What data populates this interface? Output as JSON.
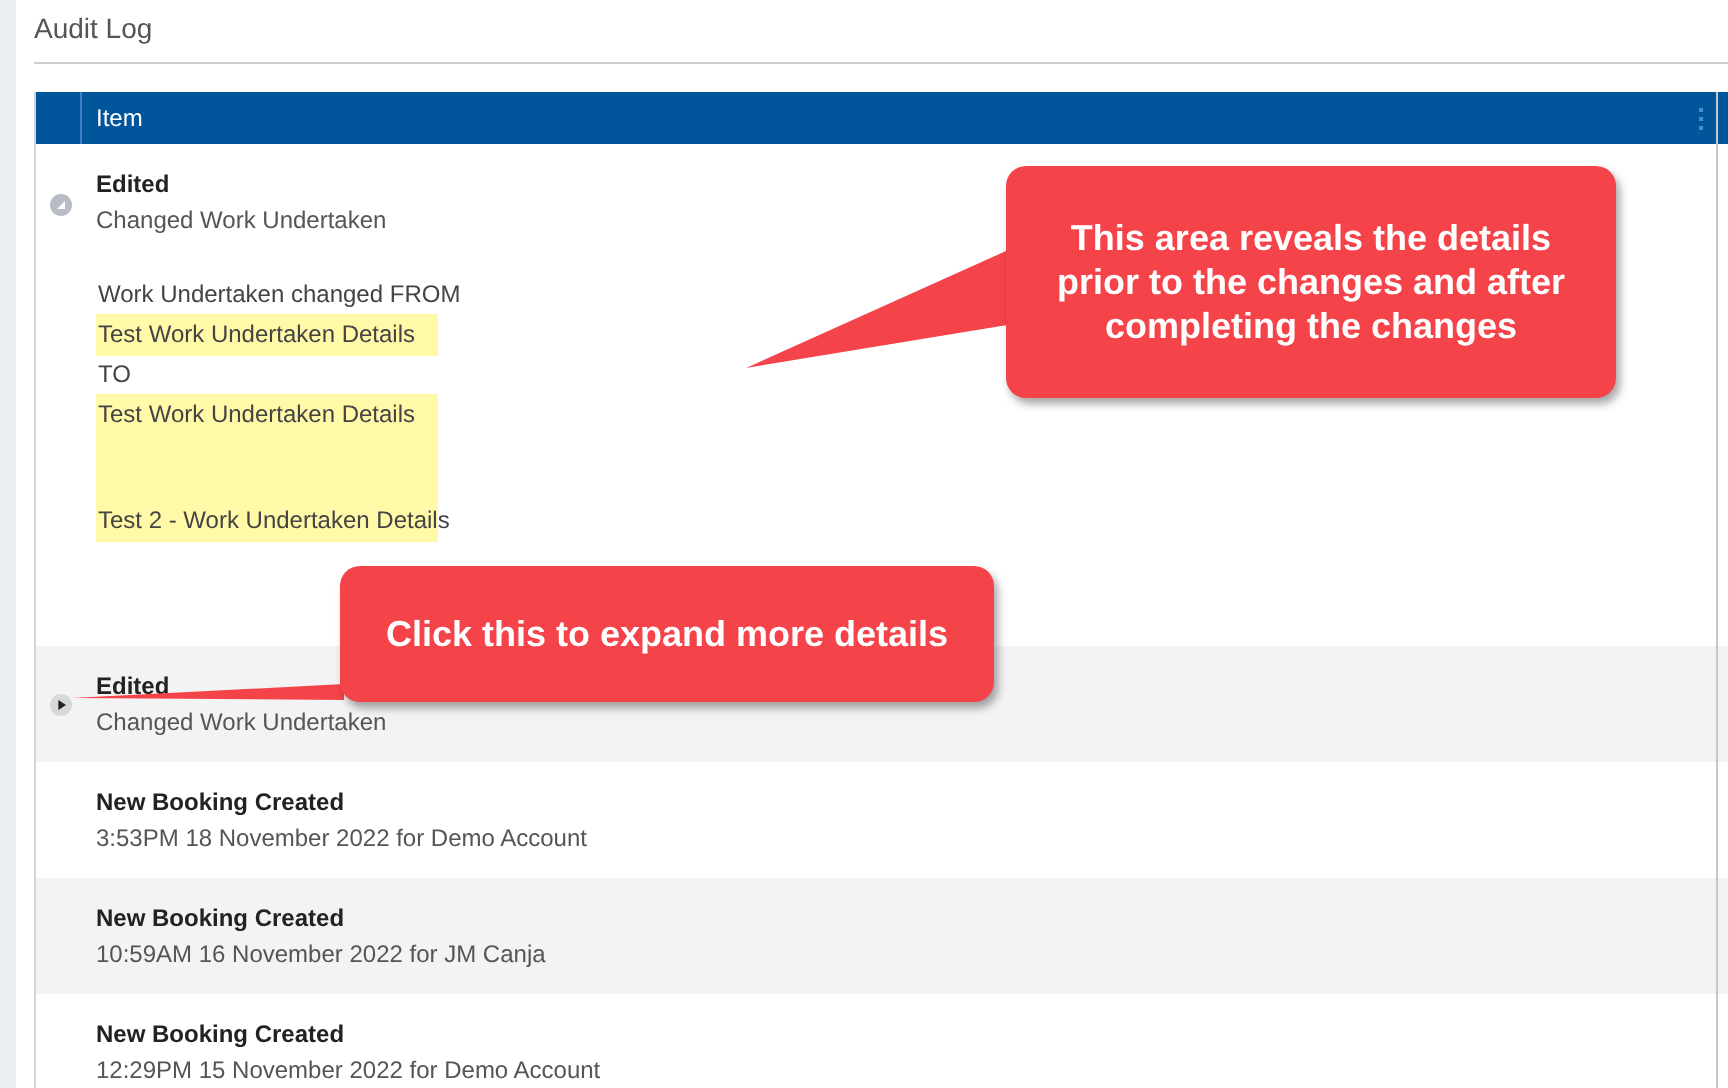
{
  "page": {
    "title": "Audit Log"
  },
  "table": {
    "columns": [
      {
        "label": "Item"
      }
    ],
    "rows": [
      {
        "title": "Edited",
        "subtitle": "Changed Work Undertaken",
        "expanded": true,
        "details": [
          {
            "highlighted": false,
            "lines": [
              "Work Undertaken changed FROM"
            ]
          },
          {
            "highlighted": true,
            "lines": [
              "Test Work Undertaken Details"
            ]
          },
          {
            "highlighted": false,
            "lines": [
              "TO"
            ]
          },
          {
            "highlighted": true,
            "lines": [
              "Test Work Undertaken Details",
              "Test 2 - Work Undertaken Details"
            ]
          }
        ]
      },
      {
        "title": "Edited",
        "subtitle": "Changed Work Undertaken",
        "expanded": false
      },
      {
        "title": "New Booking Created",
        "subtitle": "3:53PM 18 November 2022 for Demo Account"
      },
      {
        "title": "New Booking Created",
        "subtitle": "10:59AM 16 November 2022 for JM Canja"
      },
      {
        "title": "New Booking Created",
        "subtitle": "12:29PM 15 November 2022 for Demo Account"
      }
    ]
  },
  "callouts": [
    {
      "text": "This area reveals the details prior to the changes and after completing the changes"
    },
    {
      "text": "Click this to expand more details"
    }
  ]
}
